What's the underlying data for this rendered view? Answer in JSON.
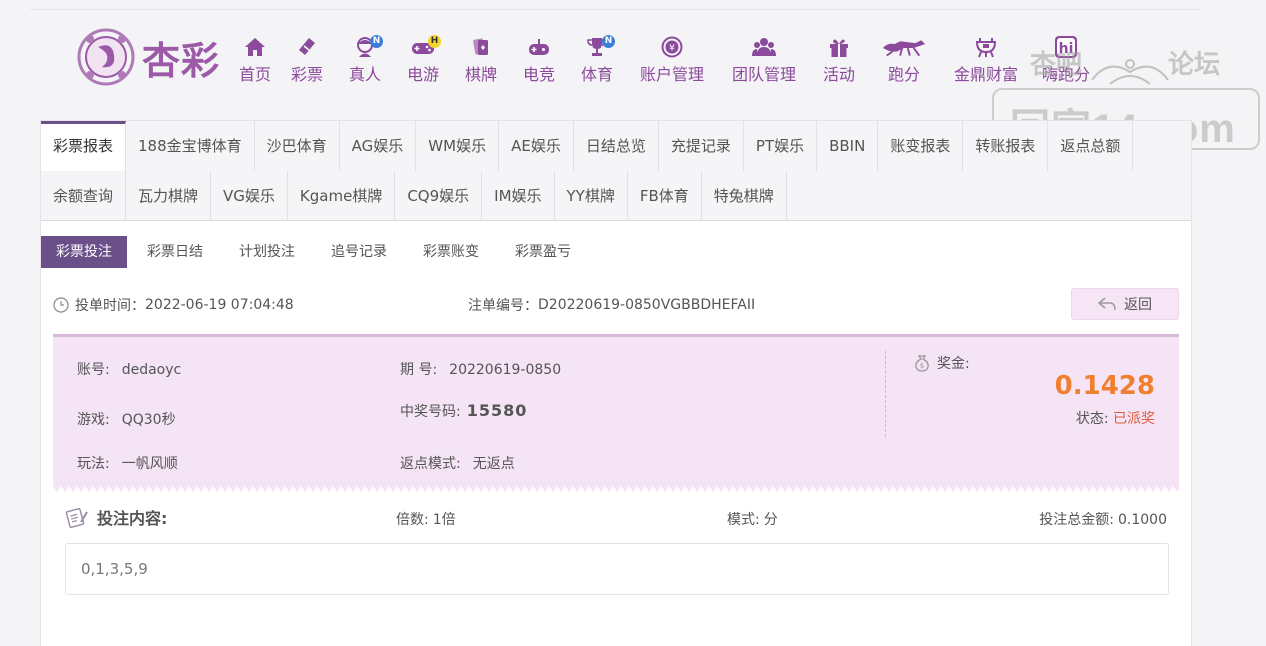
{
  "brand": {
    "logo_text": "杏彩"
  },
  "nav": [
    {
      "label": "首页",
      "icon": "home-icon"
    },
    {
      "label": "彩票",
      "icon": "lottery-ticket-icon"
    },
    {
      "label": "真人",
      "icon": "live-dealer-icon",
      "badge": "N"
    },
    {
      "label": "电游",
      "icon": "gamepad-icon",
      "badge": "H"
    },
    {
      "label": "棋牌",
      "icon": "cards-icon"
    },
    {
      "label": "电竞",
      "icon": "esports-controller-icon"
    },
    {
      "label": "体育",
      "icon": "trophy-icon",
      "badge": "N"
    },
    {
      "label": "账户管理",
      "icon": "yen-coin-icon"
    },
    {
      "label": "团队管理",
      "icon": "team-icon"
    },
    {
      "label": "活动",
      "icon": "gift-icon"
    },
    {
      "label": "跑分",
      "icon": "running-dog-icon"
    },
    {
      "label": "金鼎财富",
      "icon": "cauldron-icon"
    },
    {
      "label": "嗨跑分",
      "icon": "hi-icon"
    }
  ],
  "watermark": {
    "left": "杏吧",
    "right": "论坛",
    "site": "回家14.com"
  },
  "tabs_row1": [
    "彩票报表",
    "188金宝博体育",
    "沙巴体育",
    "AG娱乐",
    "WM娱乐",
    "AE娱乐",
    "日结总览",
    "充提记录",
    "PT娱乐",
    "BBIN",
    "账变报表",
    "转账报表",
    "返点总额"
  ],
  "tabs_row2": [
    "余额查询",
    "瓦力棋牌",
    "VG娱乐",
    "Kgame棋牌",
    "CQ9娱乐",
    "IM娱乐",
    "YY棋牌",
    "FB体育",
    "特兔棋牌"
  ],
  "sub_tabs": [
    "彩票投注",
    "彩票日结",
    "计划投注",
    "追号记录",
    "彩票账变",
    "彩票盈亏"
  ],
  "order": {
    "time_label": "投单时间：",
    "time": "2022-06-19 07:04:48",
    "no_label": "注单编号：",
    "no": "D20220619-0850VGBBDHEFAII",
    "back_label": "返回"
  },
  "detail": {
    "account_label": "账号:",
    "account": "dedaoyc",
    "game_label": "游戏:",
    "game": "QQ30秒",
    "play_label": "玩法:",
    "play": "一帆风顺",
    "issue_label": "期 号:",
    "issue": "20220619-0850",
    "win_no_label": "中奖号码:",
    "win_no": "15580",
    "rebate_label": "返点模式:",
    "rebate": "无返点",
    "prize_label": "奖金:",
    "prize": "0.1428",
    "status_label": "状态:",
    "status": "已派奖"
  },
  "content": {
    "title": "投注内容:",
    "multiple_label": "倍数:",
    "multiple": "1倍",
    "mode_label": "模式:",
    "mode": "分",
    "total_label": "投注总金额:",
    "total": "0.1000",
    "bet_numbers": "0,1,3,5,9"
  },
  "colors": {
    "primary": "#6b4f89",
    "nav": "#8b4a9c",
    "prize": "#f08030",
    "status": "#e35b3a",
    "panel": "#f4e4f5"
  }
}
